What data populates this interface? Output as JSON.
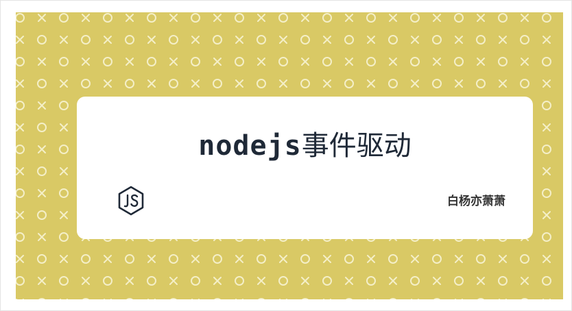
{
  "banner": {
    "title_code": "nodejs",
    "title_cn": "事件驱动",
    "author": "白杨亦萧萧",
    "logo_icon": "nodejs-icon",
    "pattern_icons": [
      "circle-outline-icon",
      "x-icon"
    ]
  },
  "colors": {
    "background_pattern": "#d9c965",
    "pattern_glyph": "#f4efc8",
    "card": "#ffffff",
    "title_text": "#1f2937",
    "logo_stroke": "#1f2937"
  }
}
